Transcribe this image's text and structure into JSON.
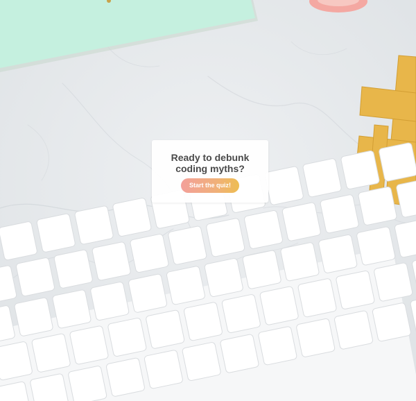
{
  "quiz_card": {
    "title": "Ready to debunk coding myths?",
    "button_label": "Start the quiz!"
  },
  "colors": {
    "button_gradient_start": "#f3a09a",
    "button_gradient_end": "#eebd52",
    "title_text": "#4a4a4a",
    "button_text": "#ffffff"
  },
  "background_objects": [
    "mint-notebook",
    "pink-tape-roll",
    "gold-hashtag",
    "white-keyboard",
    "marble-surface"
  ]
}
